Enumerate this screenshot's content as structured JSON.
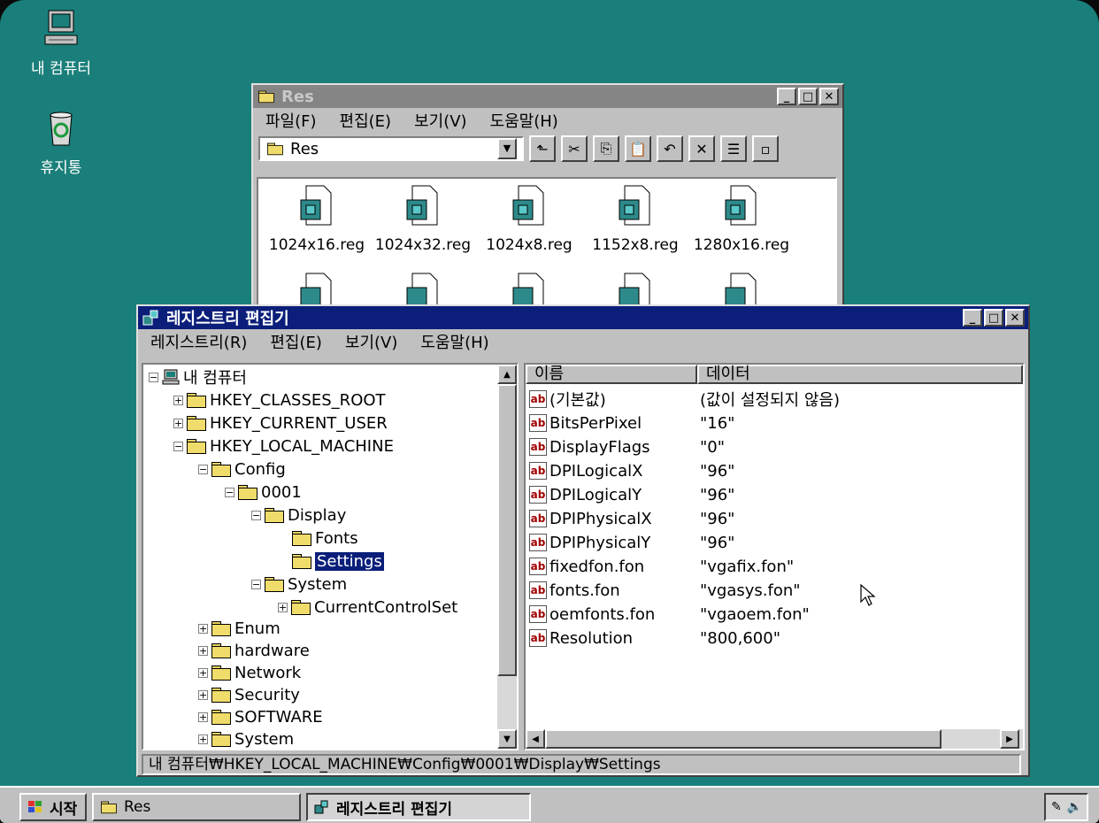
{
  "desktop": {
    "icons": [
      {
        "label": "내 컴퓨터"
      },
      {
        "label": "휴지통"
      }
    ]
  },
  "res_window": {
    "title": "Res",
    "menu": [
      "파일(F)",
      "편집(E)",
      "보기(V)",
      "도움말(H)"
    ],
    "address": "Res",
    "files": [
      "1024x16.reg",
      "1024x32.reg",
      "1024x8.reg",
      "1152x8.reg",
      "1280x16.reg"
    ]
  },
  "regedit": {
    "title": "레지스트리 편집기",
    "menu": [
      "레지스트리(R)",
      "편집(E)",
      "보기(V)",
      "도움말(H)"
    ],
    "tree": {
      "root": "내 컴퓨터",
      "items": [
        "HKEY_CLASSES_ROOT",
        "HKEY_CURRENT_USER",
        "HKEY_LOCAL_MACHINE",
        "Config",
        "0001",
        "Display",
        "Fonts",
        "Settings",
        "System",
        "CurrentControlSet",
        "Enum",
        "hardware",
        "Network",
        "Security",
        "SOFTWARE",
        "System"
      ]
    },
    "columns": {
      "name": "이름",
      "data": "데이터"
    },
    "values": [
      {
        "name": "(기본값)",
        "data": "(값이 설정되지 않음)"
      },
      {
        "name": "BitsPerPixel",
        "data": "\"16\""
      },
      {
        "name": "DisplayFlags",
        "data": "\"0\""
      },
      {
        "name": "DPILogicalX",
        "data": "\"96\""
      },
      {
        "name": "DPILogicalY",
        "data": "\"96\""
      },
      {
        "name": "DPIPhysicalX",
        "data": "\"96\""
      },
      {
        "name": "DPIPhysicalY",
        "data": "\"96\""
      },
      {
        "name": "fixedfon.fon",
        "data": "\"vgafix.fon\""
      },
      {
        "name": "fonts.fon",
        "data": "\"vgasys.fon\""
      },
      {
        "name": "oemfonts.fon",
        "data": "\"vgaoem.fon\""
      },
      {
        "name": "Resolution",
        "data": "\"800,600\""
      }
    ],
    "status": "내 컴퓨터₩HKEY_LOCAL_MACHINE₩Config₩0001₩Display₩Settings"
  },
  "taskbar": {
    "start": "시작",
    "buttons": [
      "Res",
      "레지스트리 편집기"
    ]
  },
  "colors": {
    "desktop": "#1a7f7a",
    "active_title": "#0a1e7a",
    "face": "#c0c0c0"
  }
}
